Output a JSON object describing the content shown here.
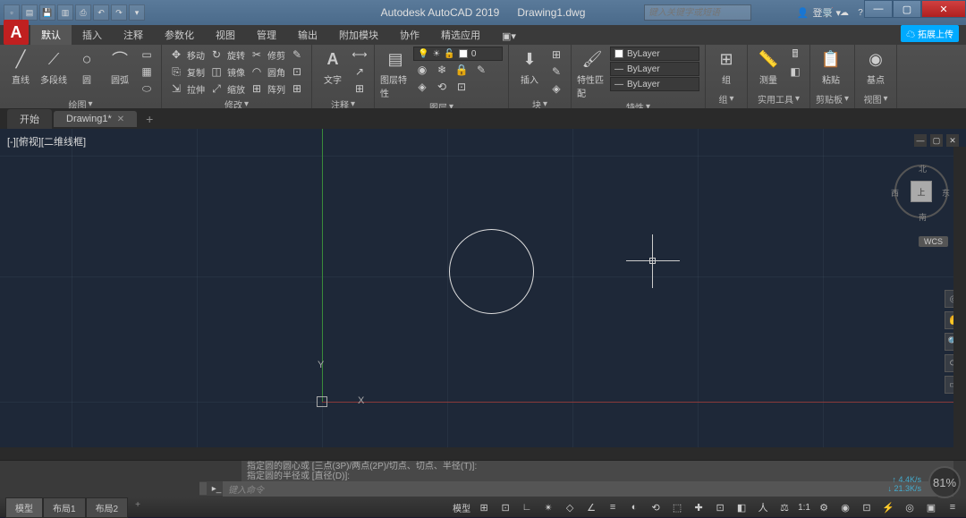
{
  "titlebar": {
    "app_name": "Autodesk AutoCAD 2019",
    "file_name": "Drawing1.dwg",
    "search_placeholder": "键入关键字或短语",
    "login_label": "登录",
    "share_label": "拓展上传"
  },
  "ribbon_tabs": [
    "默认",
    "插入",
    "注释",
    "参数化",
    "视图",
    "管理",
    "输出",
    "附加模块",
    "协作",
    "精选应用"
  ],
  "active_ribbon_tab": 0,
  "ribbon": {
    "draw": {
      "label": "绘图",
      "line": "直线",
      "polyline": "多段线",
      "circle": "圆",
      "arc": "圆弧"
    },
    "modify": {
      "label": "修改",
      "move": "移动",
      "rotate": "旋转",
      "trim": "修剪",
      "copy": "复制",
      "mirror": "镜像",
      "fillet": "圆角",
      "stretch": "拉伸",
      "scale": "缩放",
      "array": "阵列"
    },
    "annotate": {
      "label": "注释",
      "text": "文字",
      "dimension": "标注",
      "table": "表格"
    },
    "layers": {
      "label": "图层",
      "props": "图层特性",
      "current": "0"
    },
    "block": {
      "label": "块",
      "insert": "插入",
      "create": "创建",
      "edit": "编辑"
    },
    "properties": {
      "label": "特性",
      "match": "特性匹配",
      "bylayer": "ByLayer"
    },
    "group": {
      "label": "组",
      "btn": "组"
    },
    "utilities": {
      "label": "实用工具",
      "measure": "测量"
    },
    "clipboard": {
      "label": "剪贴板",
      "paste": "粘贴"
    },
    "view": {
      "label": "视图",
      "base": "基点"
    }
  },
  "file_tabs": {
    "items": [
      {
        "label": "开始",
        "active": false
      },
      {
        "label": "Drawing1*",
        "active": true
      }
    ]
  },
  "viewport": {
    "label": "[-][俯视][二维线框]",
    "cube_face": "上",
    "cube_n": "北",
    "cube_s": "南",
    "cube_e": "东",
    "cube_w": "西",
    "wcs": "WCS",
    "axis_x": "X",
    "axis_y": "Y"
  },
  "command": {
    "history1": "指定圆的圆心或 [三点(3P)/两点(2P)/切点、切点、半径(T)]:",
    "history2": "指定圆的半径或 [直径(D)]:",
    "placeholder": "键入命令"
  },
  "status": {
    "tabs": [
      "模型",
      "布局1",
      "布局2"
    ],
    "active_tab": 0,
    "model_label": "模型",
    "scale": "1:1",
    "net_up": "4.4K/s",
    "net_down": "21.3K/s",
    "percent": "81%"
  }
}
